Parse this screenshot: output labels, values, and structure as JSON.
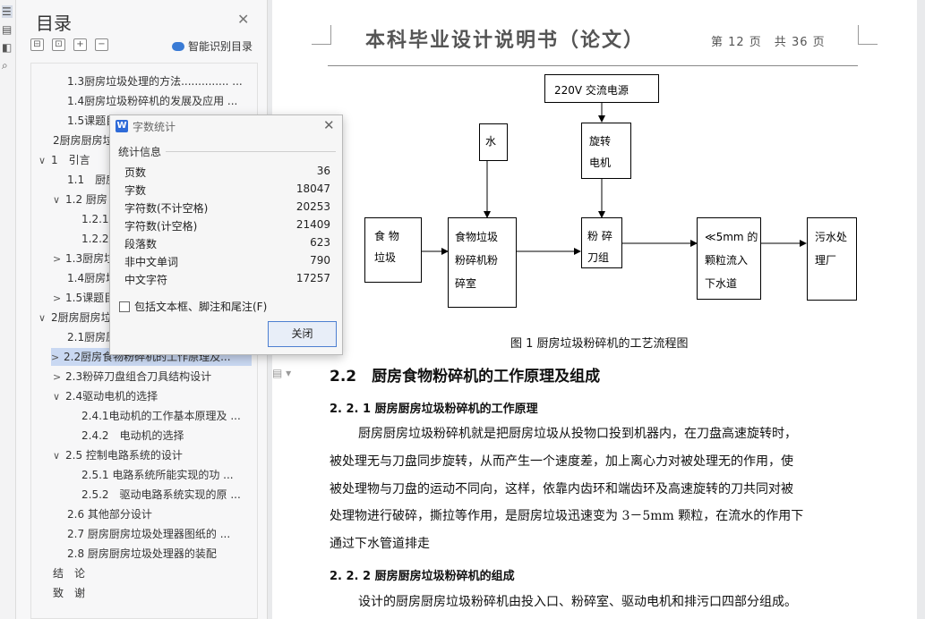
{
  "rail": {
    "icons": [
      "menu-icon",
      "document-icon",
      "bookmark-icon",
      "search-icon"
    ]
  },
  "nav": {
    "title": "目录",
    "smart_label": "智能识别目录",
    "tools": [
      "⊟",
      "⊡",
      "+",
      "−"
    ],
    "items": [
      {
        "text": "1.3厨房垃圾处理的方法.............. ...",
        "chev": ""
      },
      {
        "text": "1.4厨房垃圾粉碎机的发展及应用 ...",
        "chev": ""
      },
      {
        "text": "1.5课题目",
        "chev": ""
      },
      {
        "text": "2厨房厨房垃",
        "chev": ""
      },
      {
        "text": "1　引言",
        "chev": "∨"
      },
      {
        "text": "1.1　厨房",
        "chev": ""
      },
      {
        "text": "1.2 厨房",
        "chev": "∨"
      },
      {
        "text": "1.2.1厨",
        "chev": ""
      },
      {
        "text": "1.2.2厨",
        "chev": ""
      },
      {
        "text": "1.3厨房垃",
        "chev": ">"
      },
      {
        "text": "1.4厨房垃",
        "chev": ""
      },
      {
        "text": "1.5课题目",
        "chev": ">"
      },
      {
        "text": "2厨房厨房垃",
        "chev": "∨"
      },
      {
        "text": "2.1厨房原",
        "chev": ""
      },
      {
        "text": "2.2厨房食物粉碎机的工作原理及...",
        "chev": ">"
      },
      {
        "text": "2.3粉碎刀盘组合刀具结构设计",
        "chev": ">"
      },
      {
        "text": "2.4驱动电机的选择",
        "chev": "∨"
      },
      {
        "text": "2.4.1电动机的工作基本原理及 ...",
        "chev": ""
      },
      {
        "text": "2.4.2　电动机的选择",
        "chev": ""
      },
      {
        "text": "2.5 控制电路系统的设计",
        "chev": "∨"
      },
      {
        "text": "2.5.1 电路系统所能实现的功 ...",
        "chev": ""
      },
      {
        "text": "2.5.2　驱动电路系统实现的原 ...",
        "chev": ""
      },
      {
        "text": "2.6 其他部分设计",
        "chev": ""
      },
      {
        "text": "2.7 厨房厨房垃圾处理器图纸的 ...",
        "chev": ""
      },
      {
        "text": "2.8 厨房厨房垃圾处理器的装配",
        "chev": ""
      },
      {
        "text": "结　论",
        "chev": ""
      },
      {
        "text": "致　谢",
        "chev": ""
      }
    ]
  },
  "page": {
    "header_title": "本科毕业设计说明书（论文）",
    "header_page": "第 12 页　共 36 页",
    "flow": {
      "power": "220V 交流电源",
      "water": "水",
      "motor": [
        "旋转",
        "电机"
      ],
      "food": [
        "食 物",
        "垃圾"
      ],
      "chamber": [
        "食物垃圾",
        "粉碎机粉",
        "碎室"
      ],
      "blade": [
        "粉 碎",
        "刀组"
      ],
      "particles": [
        "≪5mm 的",
        "颗粒流入",
        "下水道"
      ],
      "plant": [
        "污水处",
        "理厂"
      ]
    },
    "figure_caption": "图 1 厨房垃圾粉碎机的工艺流程图",
    "h2": "2.2　厨房食物粉碎机的工作原理及组成",
    "h3_1": "2. 2. 1  厨房厨房垃圾粉碎机的工作原理",
    "para_1": [
      "厨房厨房垃圾粉碎机就是把厨房垃圾从投物口投到机器内，在刀盘高速旋转时，",
      "被处理无与刀盘同步旋转，从而产生一个速度差，加上离心力对被处理无的作用，使",
      "被处理物与刀盘的运动不同向，这样，依靠内齿环和端齿环及高速旋转的刀共同对被",
      "处理物进行破碎，撕拉等作用，是厨房垃圾迅速变为 3－5mm 颗粒，在流水的作用下",
      "通过下水管道排走"
    ],
    "h3_2": "2. 2. 2  厨房厨房垃圾粉碎机的组成",
    "para_2": "设计的厨房厨房垃圾粉碎机由投入口、粉碎室、驱动电机和排污口四部分组成。"
  },
  "dialog": {
    "title": "字数统计",
    "section": "统计信息",
    "stats": [
      {
        "k": "页数",
        "v": "36"
      },
      {
        "k": "字数",
        "v": "18047"
      },
      {
        "k": "字符数(不计空格)",
        "v": "20253"
      },
      {
        "k": "字符数(计空格)",
        "v": "21409"
      },
      {
        "k": "段落数",
        "v": "623"
      },
      {
        "k": "非中文单词",
        "v": "790"
      },
      {
        "k": "中文字符",
        "v": "17257"
      }
    ],
    "checkbox_label": "包括文本框、脚注和尾注(F)",
    "close_label": "关闭"
  }
}
